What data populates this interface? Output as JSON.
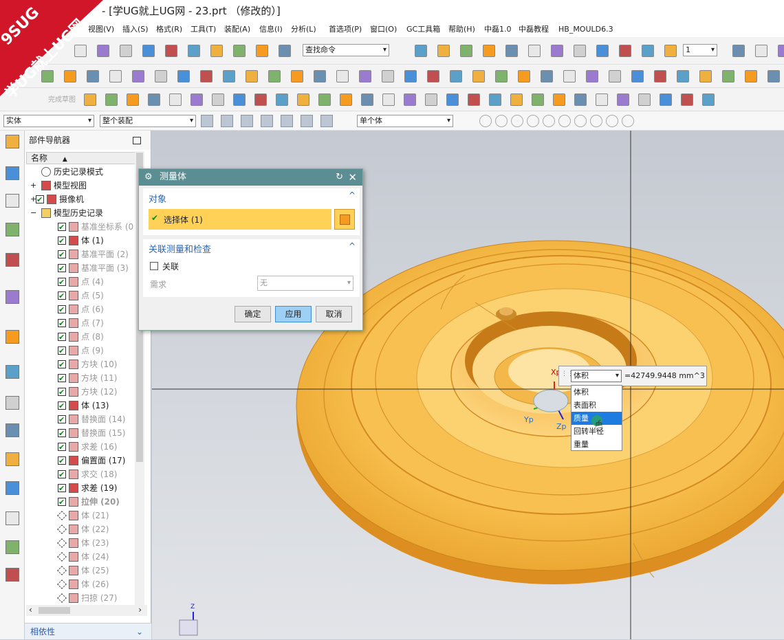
{
  "title_bar": {
    "text": "- [学UG就上UG网 - 23.prt （修改的）]"
  },
  "logo": {
    "line1": "9SUG",
    "line2": "学UG就上UG网"
  },
  "menu": [
    "视图(V)",
    "插入(S)",
    "格式(R)",
    "工具(T)",
    "装配(A)",
    "信息(I)",
    "分析(L)",
    "首选项(P)",
    "窗口(O)",
    "GC工具箱",
    "帮助(H)",
    "中磊1.0",
    "中磊教程",
    "HB_MOULD6.3"
  ],
  "toolbar": {
    "search_placeholder": "查找命令",
    "layer_value": "1",
    "sketch_finish": "完成草图",
    "filter_type": "实体",
    "filter_scope": "整个装配",
    "filter_body": "单个体"
  },
  "navigator": {
    "title": "部件导航器",
    "column_name": "名称",
    "items": [
      {
        "label": "历史记录模式",
        "indent": 0,
        "checked": null,
        "gray": false,
        "bold": false
      },
      {
        "label": "模型视图",
        "indent": 0,
        "checked": null,
        "gray": false,
        "bold": false
      },
      {
        "label": "摄像机",
        "indent": 0,
        "checked": true,
        "gray": false,
        "bold": false
      },
      {
        "label": "模型历史记录",
        "indent": 0,
        "checked": null,
        "gray": false,
        "bold": false
      },
      {
        "label": "基准坐标系 (0)",
        "indent": 1,
        "checked": true,
        "gray": true,
        "bold": false
      },
      {
        "label": "体 (1)",
        "indent": 1,
        "checked": true,
        "gray": false,
        "bold": false
      },
      {
        "label": "基准平面 (2)",
        "indent": 1,
        "checked": true,
        "gray": true,
        "bold": false
      },
      {
        "label": "基准平面 (3)",
        "indent": 1,
        "checked": true,
        "gray": true,
        "bold": false
      },
      {
        "label": "点 (4)",
        "indent": 1,
        "checked": true,
        "gray": true,
        "bold": false
      },
      {
        "label": "点 (5)",
        "indent": 1,
        "checked": true,
        "gray": true,
        "bold": false
      },
      {
        "label": "点 (6)",
        "indent": 1,
        "checked": true,
        "gray": true,
        "bold": false
      },
      {
        "label": "点 (7)",
        "indent": 1,
        "checked": true,
        "gray": true,
        "bold": false
      },
      {
        "label": "点 (8)",
        "indent": 1,
        "checked": true,
        "gray": true,
        "bold": false
      },
      {
        "label": "点 (9)",
        "indent": 1,
        "checked": true,
        "gray": true,
        "bold": false
      },
      {
        "label": "方块 (10)",
        "indent": 1,
        "checked": true,
        "gray": true,
        "bold": false
      },
      {
        "label": "方块 (11)",
        "indent": 1,
        "checked": true,
        "gray": true,
        "bold": false
      },
      {
        "label": "方块 (12)",
        "indent": 1,
        "checked": true,
        "gray": true,
        "bold": false
      },
      {
        "label": "体 (13)",
        "indent": 1,
        "checked": true,
        "gray": false,
        "bold": false
      },
      {
        "label": "替换面 (14)",
        "indent": 1,
        "checked": true,
        "gray": true,
        "bold": false
      },
      {
        "label": "替换面 (15)",
        "indent": 1,
        "checked": true,
        "gray": true,
        "bold": false
      },
      {
        "label": "求差 (16)",
        "indent": 1,
        "checked": true,
        "gray": true,
        "bold": false
      },
      {
        "label": "偏置面 (17)",
        "indent": 1,
        "checked": true,
        "gray": false,
        "bold": false
      },
      {
        "label": "求交 (18)",
        "indent": 1,
        "checked": true,
        "gray": true,
        "bold": false
      },
      {
        "label": "求差 (19)",
        "indent": 1,
        "checked": true,
        "gray": false,
        "bold": false
      },
      {
        "label": "拉伸 (20)",
        "indent": 1,
        "checked": true,
        "gray": true,
        "bold": true
      },
      {
        "label": "体 (21)",
        "indent": 1,
        "checked": false,
        "gray": true,
        "bold": false
      },
      {
        "label": "体 (22)",
        "indent": 1,
        "checked": false,
        "gray": true,
        "bold": false
      },
      {
        "label": "体 (23)",
        "indent": 1,
        "checked": false,
        "gray": true,
        "bold": false
      },
      {
        "label": "体 (24)",
        "indent": 1,
        "checked": false,
        "gray": true,
        "bold": false
      },
      {
        "label": "体 (25)",
        "indent": 1,
        "checked": false,
        "gray": true,
        "bold": false
      },
      {
        "label": "体 (26)",
        "indent": 1,
        "checked": false,
        "gray": true,
        "bold": false
      },
      {
        "label": "扫掠 (27)",
        "indent": 1,
        "checked": false,
        "gray": true,
        "bold": false
      }
    ],
    "dependency": "相依性"
  },
  "dialog": {
    "title": "测量体",
    "section_object": "对象",
    "select_body": "选择体 (1)",
    "section_assoc": "关联测量和检查",
    "assoc_label": "关联",
    "need_label": "需求",
    "need_value": "无",
    "ok": "确定",
    "apply": "应用",
    "cancel": "取消"
  },
  "measure": {
    "type_selected": "体积",
    "result": "=42749.9448 mm^3",
    "options": [
      "体积",
      "表面积",
      "质量",
      "回转半径",
      "重量"
    ],
    "highlighted_index": 2
  },
  "axes": {
    "x": "Xp",
    "y": "Yp",
    "z": "Zp",
    "triad_z": "Z"
  },
  "colors": {
    "part": "#f6b33a",
    "dialog_title": "#5b8e93",
    "logo_red": "#d1162a",
    "accent_blue": "#1e7be0"
  }
}
